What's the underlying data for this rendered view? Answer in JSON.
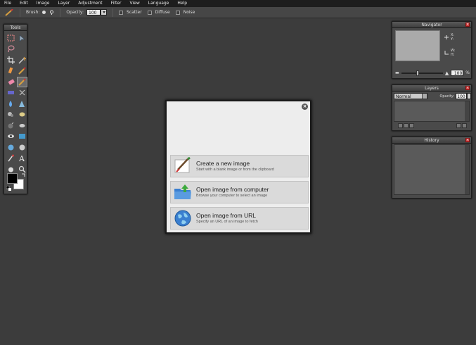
{
  "menu": [
    "File",
    "Edit",
    "Image",
    "Layer",
    "Adjustment",
    "Filter",
    "View",
    "Language",
    "Help"
  ],
  "options": {
    "brush_label": "Brush:",
    "opacity_label": "Opacity:",
    "opacity_value": "100",
    "scatter_label": "Scatter",
    "diffuse_label": "Diffuse",
    "noise_label": "Noise"
  },
  "tools_panel": {
    "title": "Tools"
  },
  "navigator": {
    "title": "Navigator",
    "x_label": "X:",
    "y_label": "Y:",
    "w_label": "W:",
    "h_label": "H:",
    "zoom_value": "100",
    "zoom_unit": "%"
  },
  "layers": {
    "title": "Layers",
    "blend_mode": "Normal",
    "opacity_label": "Opacity:",
    "opacity_value": "100"
  },
  "history": {
    "title": "History"
  },
  "dialog": {
    "options": [
      {
        "title": "Create a new image",
        "subtitle": "Start with a blank image or from the clipboard",
        "icon": "paintbrush-canvas-icon"
      },
      {
        "title": "Open image from computer",
        "subtitle": "Browse your computer to select an image",
        "icon": "folder-upload-icon"
      },
      {
        "title": "Open image from URL",
        "subtitle": "Specify an URL of an image to fetch",
        "icon": "globe-icon"
      }
    ]
  },
  "colors": {
    "foreground": "#000000",
    "background": "#ffffff",
    "workspace": "#3c3c3c",
    "close_red": "#cc3333"
  }
}
